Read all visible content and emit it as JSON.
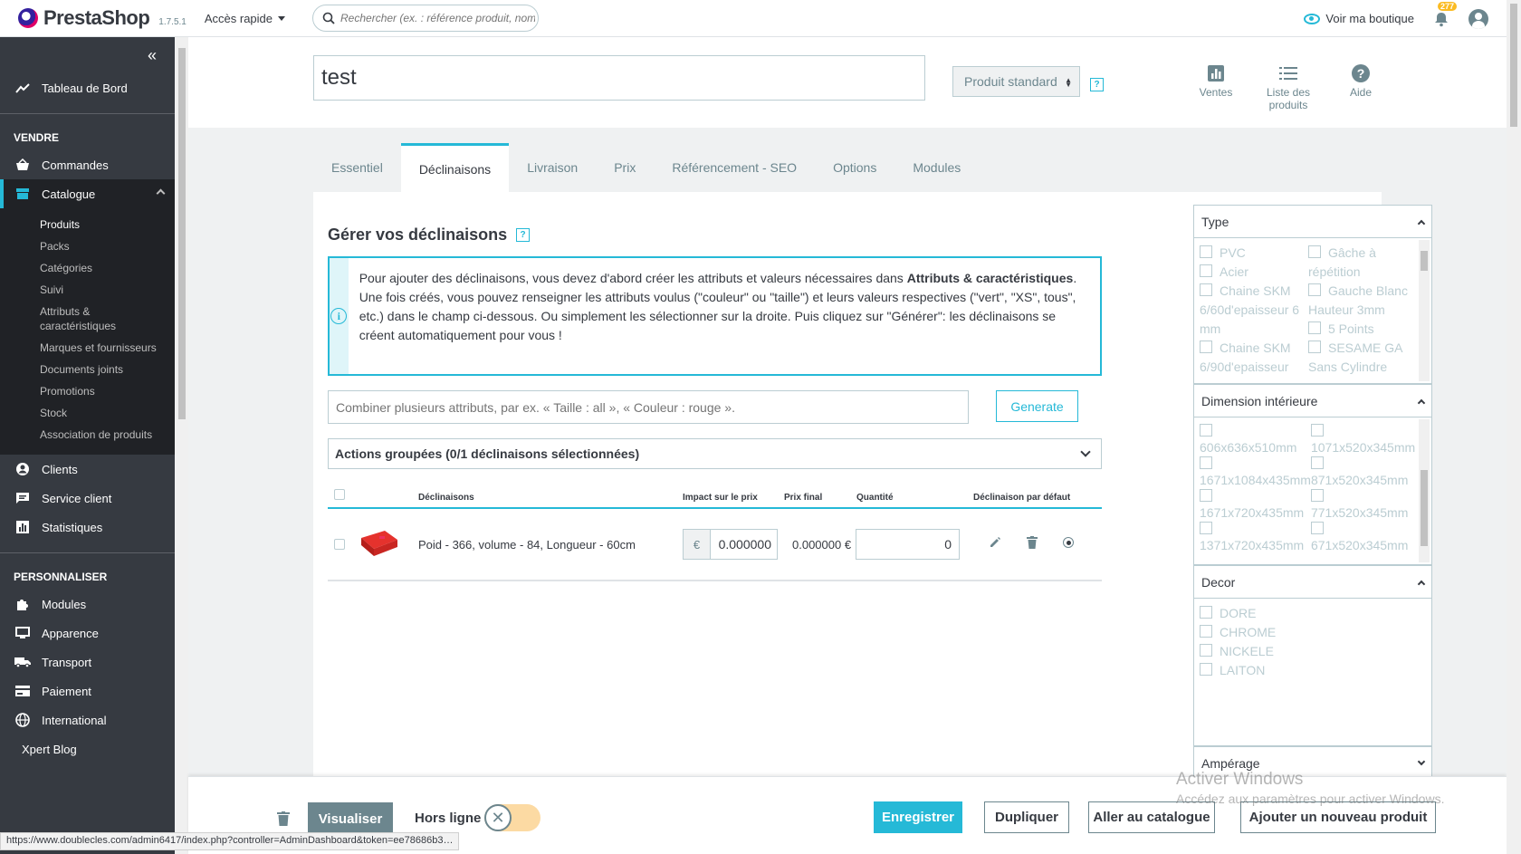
{
  "header": {
    "logo": "PrestaShop",
    "version": "1.7.5.1",
    "quick_access": "Accès rapide",
    "search_placeholder": "Rechercher (ex. : référence produit, nom",
    "view_shop": "Voir ma boutique",
    "notifications_count": "277"
  },
  "sidebar": {
    "dashboard": "Tableau de Bord",
    "section_sell": "VENDRE",
    "orders": "Commandes",
    "catalog": "Catalogue",
    "catalog_sub": [
      "Produits",
      "Packs",
      "Catégories",
      "Suivi",
      "Attributs & caractéristiques",
      "Marques et fournisseurs",
      "Documents joints",
      "Promotions",
      "Stock",
      "Association de produits"
    ],
    "clients": "Clients",
    "customer_service": "Service client",
    "stats": "Statistiques",
    "section_customize": "PERSONNALISER",
    "modules": "Modules",
    "appearance": "Apparence",
    "shipping": "Transport",
    "payment": "Paiement",
    "international": "International",
    "blog": "Xpert Blog"
  },
  "toolbar": {
    "product_name": "test",
    "product_type": "Produit standard",
    "help_glyph": "?",
    "sales": "Ventes",
    "product_list_line1": "Liste des",
    "product_list_line2": "produits",
    "help": "Aide"
  },
  "tabs": [
    "Essentiel",
    "Déclinaisons",
    "Livraison",
    "Prix",
    "Référencement - SEO",
    "Options",
    "Modules"
  ],
  "combinations": {
    "title": "Gérer vos déclinaisons",
    "info_line1_a": "Pour ajouter des déclinaisons, vous devez d'abord créer les attributs et valeurs nécessaires dans ",
    "info_line1_b": "Attributs & caractéristiques",
    "info_line2": "Une fois créés, vous pouvez renseigner les attributs voulus (\"couleur\" ou \"taille\") et leurs valeurs respectives (\"vert\", \"XS\", tous\", etc.) dans le champ ci-dessous. Ou simplement les sélectionner sur la droite. Puis cliquez sur \"Générer\": les déclinaisons se créent automatiquement pour vous !",
    "combine_placeholder": "Combiner plusieurs attributs, par ex. « Taille : all », « Couleur : rouge ».",
    "generate": "Generate",
    "bulk_actions": "Actions groupées (0/1 déclinaisons sélectionnées)",
    "columns": {
      "name": "Déclinaisons",
      "impact": "Impact sur le prix",
      "final_price": "Prix final",
      "quantity": "Quantité",
      "default": "Déclinaison par défaut"
    },
    "rows": [
      {
        "name": "Poid - 366, volume - 84, Longueur - 60cm",
        "currency": "€",
        "impact": "0.000000",
        "final_price": "0.000000 €",
        "quantity": "0"
      }
    ]
  },
  "attributes": {
    "type": {
      "title": "Type",
      "col1": [
        "PVC",
        "Acier",
        "Chaine SKM 6/60d'epaisseur 6 mm",
        "Chaine SKM 6/90d'epaisseur"
      ],
      "col2": [
        "Gâche à répétition",
        "Gauche Blanc Hauteur 3mm",
        "5 Points",
        "SESAME GA Sans Cylindre"
      ]
    },
    "dimension": {
      "title": "Dimension intérieure",
      "col1": [
        "606x636x510mm",
        "1671x1084x435mm",
        "1671x720x435mm",
        "1371x720x435mm"
      ],
      "col2": [
        "1071x520x345mm",
        "871x520x345mm",
        "771x520x345mm",
        "671x520x345mm"
      ]
    },
    "decor": {
      "title": "Decor",
      "items": [
        "DORE",
        "CHROME",
        "NICKELE",
        "LAITON"
      ]
    },
    "amperage": {
      "title": "Ampérage"
    }
  },
  "footer": {
    "preview": "Visualiser",
    "offline": "Hors ligne",
    "save": "Enregistrer",
    "duplicate": "Dupliquer",
    "go_catalog": "Aller au catalogue",
    "add_new": "Ajouter un nouveau produit"
  },
  "windows_watermark": {
    "title": "Activer Windows",
    "subtitle": "Accédez aux paramètres pour activer Windows."
  },
  "status_url": "https://www.doublecles.com/admin6417/index.php?controller=AdminDashboard&token=ee78686b3…",
  "colors": {
    "accent": "#25b9d7",
    "sidebar": "#363a41",
    "brand": "#df0067"
  }
}
